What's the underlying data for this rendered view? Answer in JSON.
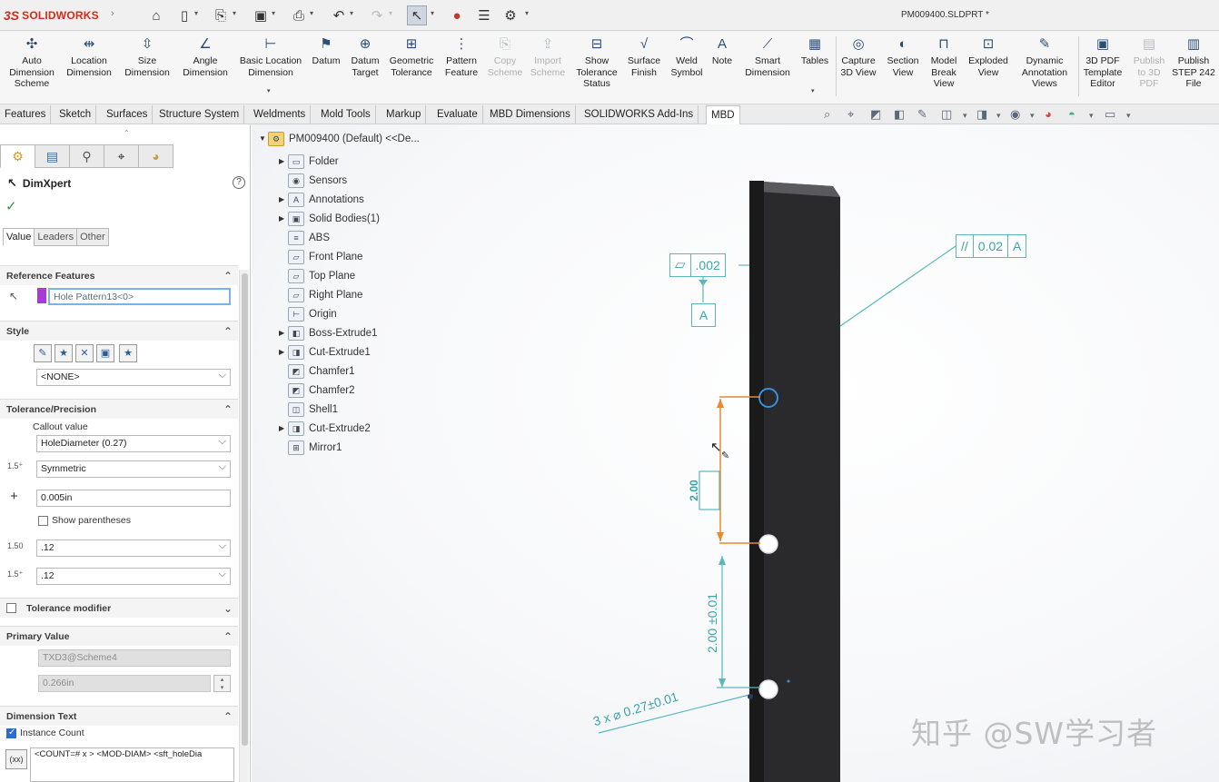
{
  "app": {
    "logo_ds": "3S",
    "logo_name": "SOLIDWORKS",
    "document_title": "PM009400.SLDPRT *"
  },
  "ribbon": [
    {
      "label": "Auto\nDimension\nScheme",
      "icon": "auto-dimension-icon",
      "disabled": false
    },
    {
      "label": "Location\nDimension",
      "icon": "location-dimension-icon",
      "disabled": false
    },
    {
      "label": "Size\nDimension",
      "icon": "size-dimension-icon",
      "disabled": false
    },
    {
      "label": "Angle\nDimension",
      "icon": "angle-dimension-icon",
      "disabled": false
    },
    {
      "label": "Basic Location\nDimension",
      "icon": "basic-location-icon",
      "disabled": false
    },
    {
      "label": "Datum",
      "icon": "datum-icon",
      "disabled": false
    },
    {
      "label": "Datum\nTarget",
      "icon": "datum-target-icon",
      "disabled": false
    },
    {
      "label": "Geometric\nTolerance",
      "icon": "geometric-tolerance-icon",
      "disabled": false
    },
    {
      "label": "Pattern\nFeature",
      "icon": "pattern-feature-icon",
      "disabled": false
    },
    {
      "label": "Copy\nScheme",
      "icon": "copy-scheme-icon",
      "disabled": true
    },
    {
      "label": "Import\nScheme",
      "icon": "import-scheme-icon",
      "disabled": true
    },
    {
      "label": "Show\nTolerance\nStatus",
      "icon": "tolerance-status-icon",
      "disabled": false
    },
    {
      "label": "Surface\nFinish",
      "icon": "surface-finish-icon",
      "disabled": false
    },
    {
      "label": "Weld\nSymbol",
      "icon": "weld-symbol-icon",
      "disabled": false
    },
    {
      "label": "Note",
      "icon": "note-icon",
      "disabled": false
    },
    {
      "label": "Smart\nDimension",
      "icon": "smart-dimension-icon",
      "disabled": false
    },
    {
      "label": "Tables",
      "icon": "tables-icon",
      "disabled": false
    },
    {
      "label": "Capture\n3D View",
      "icon": "capture-view-icon",
      "disabled": false
    },
    {
      "label": "Section\nView",
      "icon": "section-view-icon",
      "disabled": false
    },
    {
      "label": "Model\nBreak\nView",
      "icon": "model-break-icon",
      "disabled": false
    },
    {
      "label": "Exploded\nView",
      "icon": "exploded-view-icon",
      "disabled": false
    },
    {
      "label": "Dynamic\nAnnotation\nViews",
      "icon": "dynamic-annotation-icon",
      "disabled": false
    },
    {
      "label": "3D PDF\nTemplate\nEditor",
      "icon": "pdf-template-icon",
      "disabled": false
    },
    {
      "label": "Publish\nto 3D\nPDF",
      "icon": "publish-pdf-icon",
      "disabled": true
    },
    {
      "label": "Publish\nSTEP 242\nFile",
      "icon": "publish-step-icon",
      "disabled": false
    }
  ],
  "command_tabs": [
    "Features",
    "Sketch",
    "Surfaces",
    "Structure System",
    "Weldments",
    "Mold Tools",
    "Markup",
    "Evaluate",
    "MBD Dimensions",
    "SOLIDWORKS Add-Ins",
    "MBD"
  ],
  "active_command_tab": "MBD",
  "panel": {
    "title": "DimXpert",
    "help": "?",
    "subtabs": [
      "Value",
      "Leaders",
      "Other"
    ],
    "reference_features": {
      "header": "Reference Features",
      "value": "Hole Pattern13<0>"
    },
    "style": {
      "header": "Style",
      "value": "<NONE>"
    },
    "tolerance": {
      "header": "Tolerance/Precision",
      "callout_label": "Callout value",
      "callout_value": "HoleDiameter (0.27)",
      "type_value": "Symmetric",
      "plus_value": "0.005in",
      "show_parentheses": "Show parentheses",
      "precision1": ".12",
      "precision2": ".12"
    },
    "tolerance_modifier": {
      "header": "Tolerance modifier"
    },
    "primary_value": {
      "header": "Primary Value",
      "name": "TXD3@Scheme4",
      "value": "0.266in"
    },
    "dimension_text": {
      "header": "Dimension Text",
      "instance_count": "Instance Count",
      "text": "<COUNT=# x > <MOD-DIAM> <sft_holeDia"
    }
  },
  "tree": [
    {
      "label": "PM009400 (Default) <<De...",
      "expand": "▼",
      "icon": "part-icon"
    },
    {
      "label": "Folder",
      "expand": "▶",
      "icon": "folder-icon"
    },
    {
      "label": "Sensors",
      "expand": "",
      "icon": "sensors-icon"
    },
    {
      "label": "Annotations",
      "expand": "▶",
      "icon": "annotations-icon"
    },
    {
      "label": "Solid Bodies(1)",
      "expand": "▶",
      "icon": "solid-bodies-icon"
    },
    {
      "label": "ABS",
      "expand": "",
      "icon": "material-icon"
    },
    {
      "label": "Front Plane",
      "expand": "",
      "icon": "plane-icon"
    },
    {
      "label": "Top Plane",
      "expand": "",
      "icon": "plane-icon"
    },
    {
      "label": "Right Plane",
      "expand": "",
      "icon": "plane-icon"
    },
    {
      "label": "Origin",
      "expand": "",
      "icon": "origin-icon"
    },
    {
      "label": "Boss-Extrude1",
      "expand": "▶",
      "icon": "extrude-icon"
    },
    {
      "label": "Cut-Extrude1",
      "expand": "▶",
      "icon": "cut-extrude-icon"
    },
    {
      "label": "Chamfer1",
      "expand": "",
      "icon": "chamfer-icon"
    },
    {
      "label": "Chamfer2",
      "expand": "",
      "icon": "chamfer-icon"
    },
    {
      "label": "Shell1",
      "expand": "",
      "icon": "shell-icon"
    },
    {
      "label": "Cut-Extrude2",
      "expand": "▶",
      "icon": "cut-extrude-icon"
    },
    {
      "label": "Mirror1",
      "expand": "",
      "icon": "mirror-icon"
    }
  ],
  "annotations": {
    "flatness_value": ".002",
    "datum_label": "A",
    "parallel_value": "0.02",
    "parallel_datum": "A",
    "vertical_dim": "2.00 ±0.01",
    "active_dim": "2.00",
    "hole_callout": "3 x ⌀ 0.27±0.01"
  },
  "watermark": "知乎 @SW学习者",
  "colors": {
    "accent": "#3aa3aa",
    "active_dim": "#e58a2d",
    "hole_ring": "#3a8fdb",
    "brand": "#d42a1a"
  }
}
